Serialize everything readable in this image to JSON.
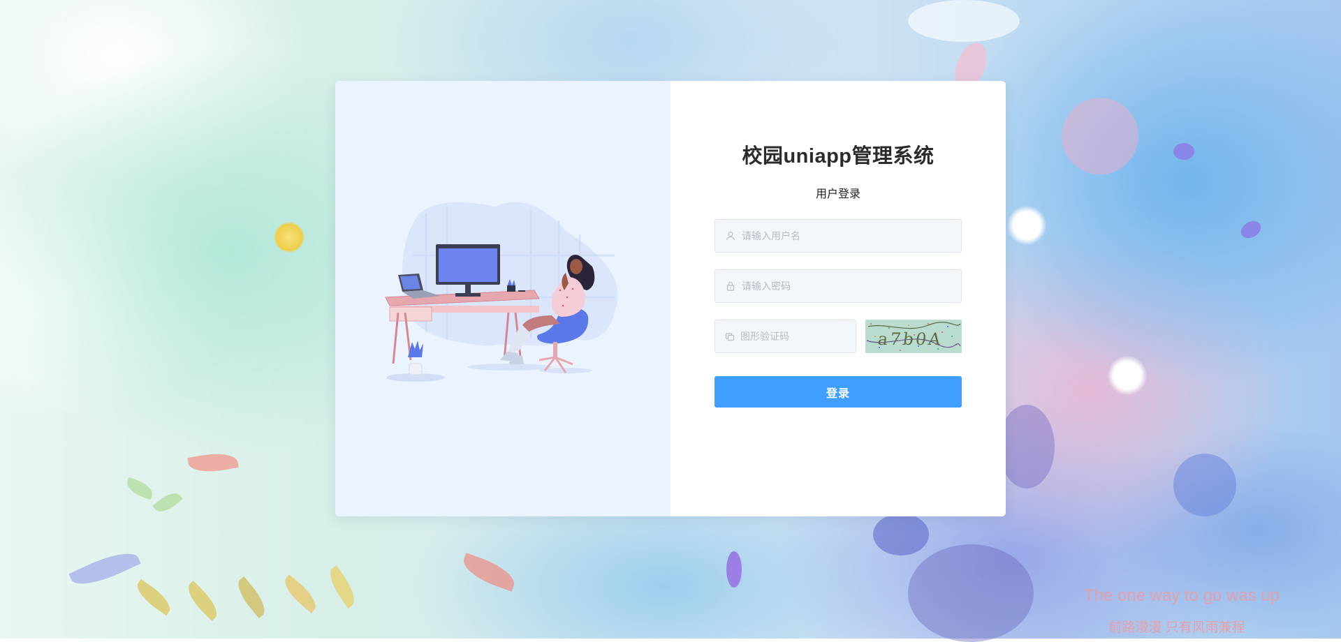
{
  "login": {
    "app_title": "校园uniapp管理系统",
    "subtitle": "用户登录",
    "username_placeholder": "请输入用户名",
    "password_placeholder": "请输入密码",
    "captcha_placeholder": "图形验证码",
    "captcha_text": "a7b0A",
    "submit_label": "登录"
  },
  "watermark": {
    "english": "The one way to go was up",
    "chinese": "前路漫漫 只有风雨兼程"
  },
  "colors": {
    "primary_button": "#409eff",
    "left_panel_bg": "#ebf3fe",
    "watermark": "#f09aa0"
  },
  "icons": {
    "username": "user-icon",
    "password": "lock-icon",
    "captcha": "captcha-icon"
  }
}
